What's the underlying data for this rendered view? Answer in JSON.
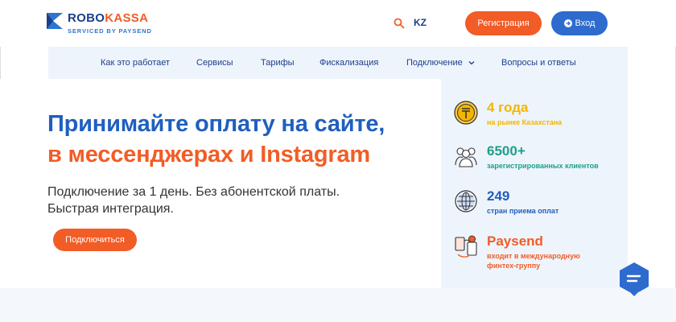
{
  "header": {
    "logo": {
      "name_part1": "ROBO",
      "name_part2": "KASSA",
      "subtitle": "SERVICED BY PAYSEND"
    },
    "language": "KZ",
    "register_label": "Регистрация",
    "login_label": "Вход"
  },
  "nav": {
    "items": [
      {
        "label": "Как это работает"
      },
      {
        "label": "Сервисы"
      },
      {
        "label": "Тарифы"
      },
      {
        "label": "Фискализация"
      },
      {
        "label": "Подключение"
      },
      {
        "label": "Вопросы и ответы"
      }
    ]
  },
  "hero": {
    "title_line1": "Принимайте оплату на сайте,",
    "title_line2": "в мессенджерах и Instagram",
    "subtitle_line1": "Подключение за 1 день. Без абонентской платы.",
    "subtitle_line2": "Быстрая интеграция.",
    "cta_label": "Подключиться"
  },
  "stats": [
    {
      "value": "4 года",
      "desc_line1": "на рынке Казахстана",
      "desc_line2": "",
      "color": "#f2b600",
      "icon": "tenge-coin-icon"
    },
    {
      "value": "6500+",
      "desc_line1": "зарегистрированных клиентов",
      "desc_line2": "",
      "color": "#1f9e8a",
      "icon": "clients-icon"
    },
    {
      "value": "249",
      "desc_line1": "стран приема оплат",
      "desc_line2": "",
      "color": "#1f5fbf",
      "icon": "globe-icon"
    },
    {
      "value": "Paysend",
      "desc_line1": "входит в международную",
      "desc_line2": "финтех-группу",
      "color": "#f25c26",
      "icon": "fintech-icon"
    }
  ],
  "colors": {
    "accent": "#f25c26",
    "primary": "#1f5fbf",
    "nav_bg": "#eef4fb"
  }
}
